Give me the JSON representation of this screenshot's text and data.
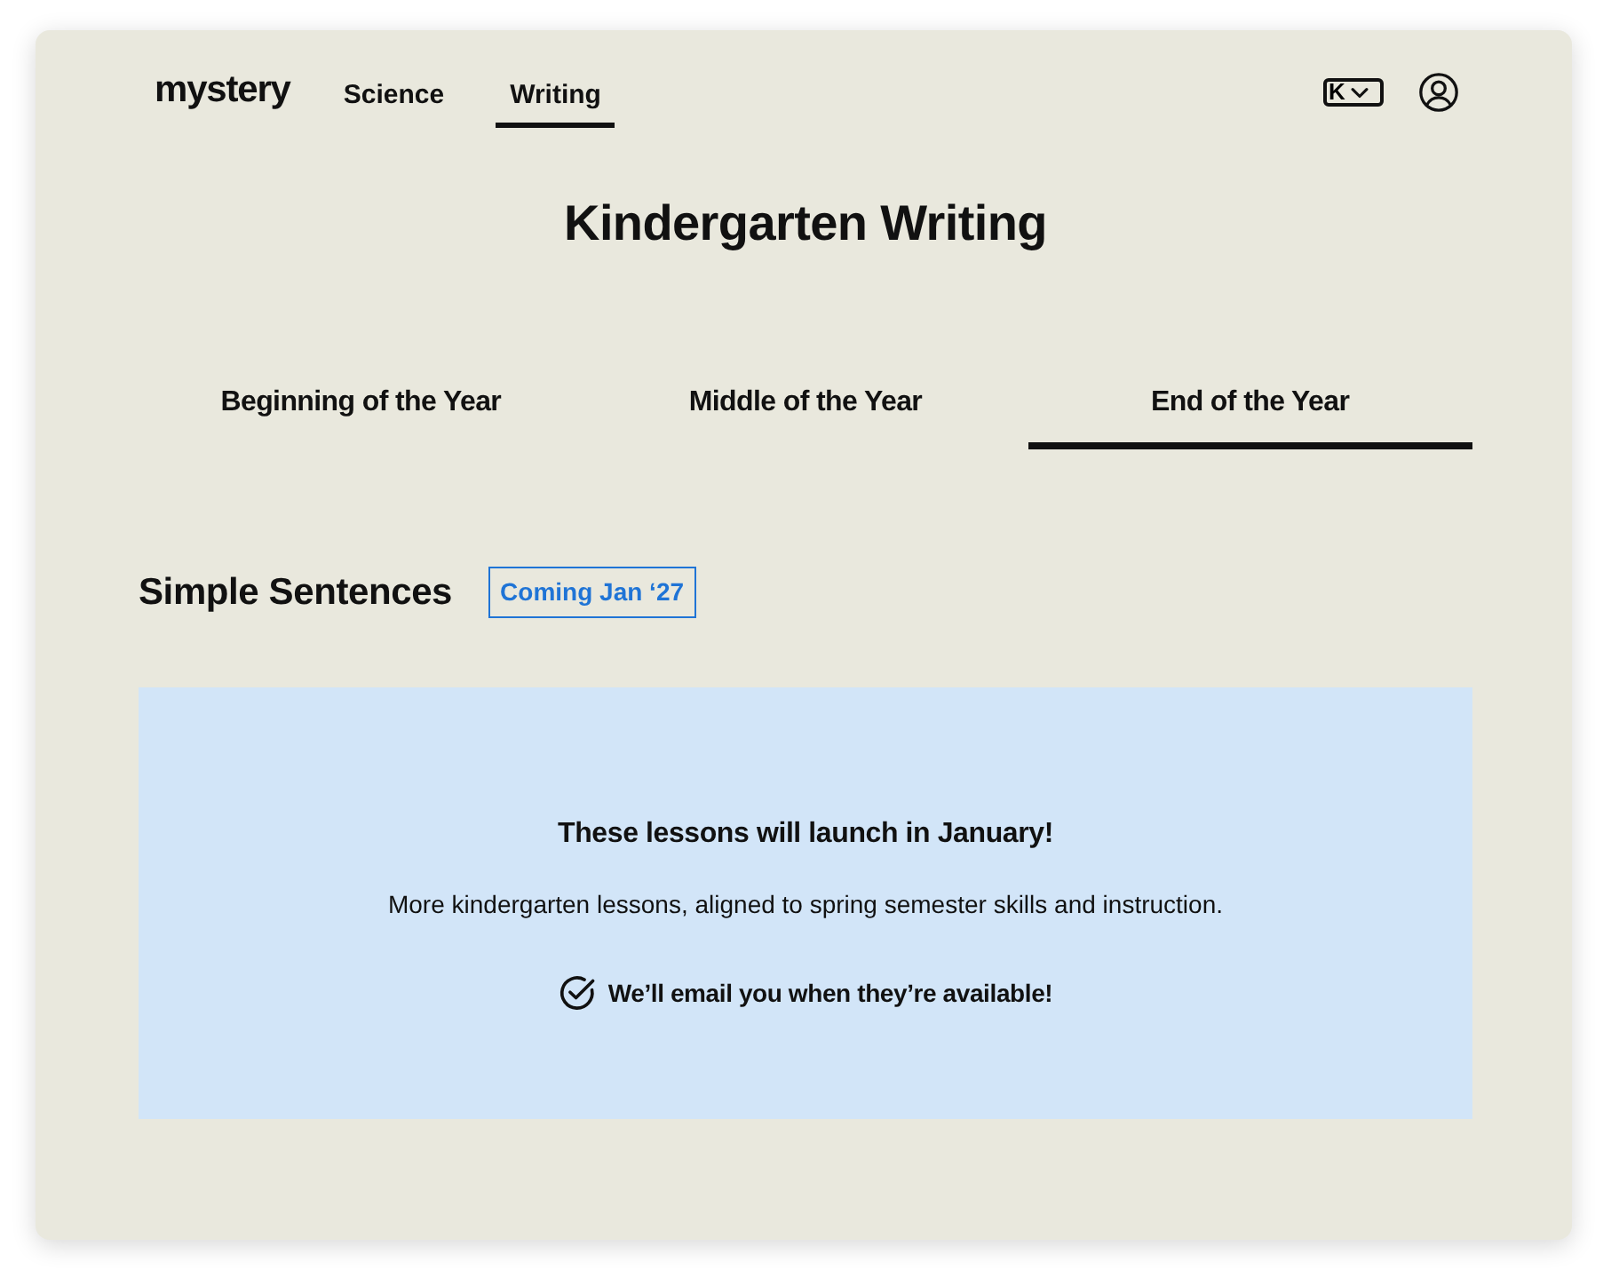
{
  "logo": "mystery",
  "nav": {
    "links": [
      {
        "label": "Science",
        "selected": false
      },
      {
        "label": "Writing",
        "selected": true
      }
    ],
    "grade_selector": {
      "value": "K"
    }
  },
  "page_title": "Kindergarten Writing",
  "tabs": [
    {
      "label": "Beginning of the Year",
      "selected": false
    },
    {
      "label": "Middle of the Year",
      "selected": false
    },
    {
      "label": "End of the Year",
      "selected": true
    }
  ],
  "section": {
    "title": "Simple Sentences",
    "badge": "Coming Jan ‘27"
  },
  "notice": {
    "heading": "These lessons will launch in January!",
    "body": "More kindergarten lessons, aligned to spring semester skills and instruction.",
    "confirmation": "We’ll email you when they’re available!"
  }
}
